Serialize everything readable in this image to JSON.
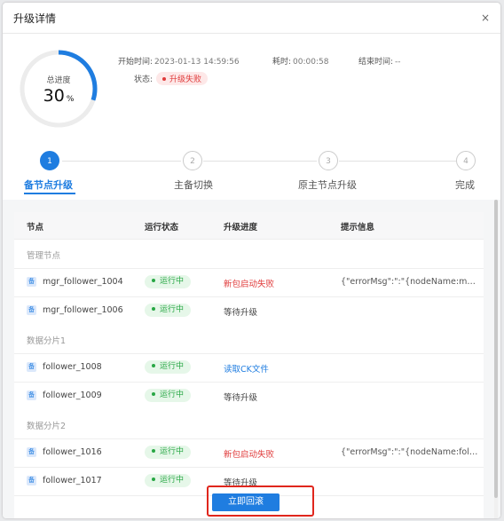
{
  "dialog": {
    "title": "升级详情",
    "close_icon": "×"
  },
  "summary": {
    "progress_label": "总进度",
    "progress_value": "30",
    "progress_unit": "%",
    "progress_fraction": 0.3,
    "start_label": "开始时间:",
    "start_value": "2023-01-13 14:59:56",
    "elapsed_label": "耗时:",
    "elapsed_value": "00:00:58",
    "end_label": "结束时间:",
    "end_value": "--",
    "status_label": "状态:",
    "status_value": "升级失败"
  },
  "steps": [
    {
      "number": "1",
      "label": "备节点升级",
      "active": true
    },
    {
      "number": "2",
      "label": "主备切换",
      "active": false
    },
    {
      "number": "3",
      "label": "原主节点升级",
      "active": false
    },
    {
      "number": "4",
      "label": "完成",
      "active": false
    }
  ],
  "table": {
    "headers": [
      "节点",
      "运行状态",
      "升级进度",
      "提示信息"
    ],
    "groups": [
      {
        "label": "管理节点"
      },
      {
        "label": "数据分片1"
      },
      {
        "label": "数据分片2"
      }
    ],
    "rows": [
      {
        "node": "mgr_follower_1004",
        "status": "运行中",
        "progress": "新包启动失败",
        "message": "{\"errorMsg\":\":\"{nodeName:mgr_follo..."
      },
      {
        "node": "mgr_follower_1006",
        "status": "运行中",
        "progress": "等待升级",
        "message": ""
      },
      {
        "node": "follower_1008",
        "status": "运行中",
        "progress": "读取CK文件",
        "message": ""
      },
      {
        "node": "follower_1009",
        "status": "运行中",
        "progress": "等待升级",
        "message": ""
      },
      {
        "node": "follower_1016",
        "status": "运行中",
        "progress": "新包启动失败",
        "message": "{\"errorMsg\":\":\"{nodeName:follower_..."
      },
      {
        "node": "follower_1017",
        "status": "运行中",
        "progress": "等待升级",
        "message": ""
      }
    ],
    "node_icon": "备"
  },
  "actions": {
    "rollback_label": "立即回滚"
  },
  "colors": {
    "accent": "#1f7de0",
    "error": "#e03b3b",
    "success": "#28a745",
    "highlight": "#e0261d"
  }
}
